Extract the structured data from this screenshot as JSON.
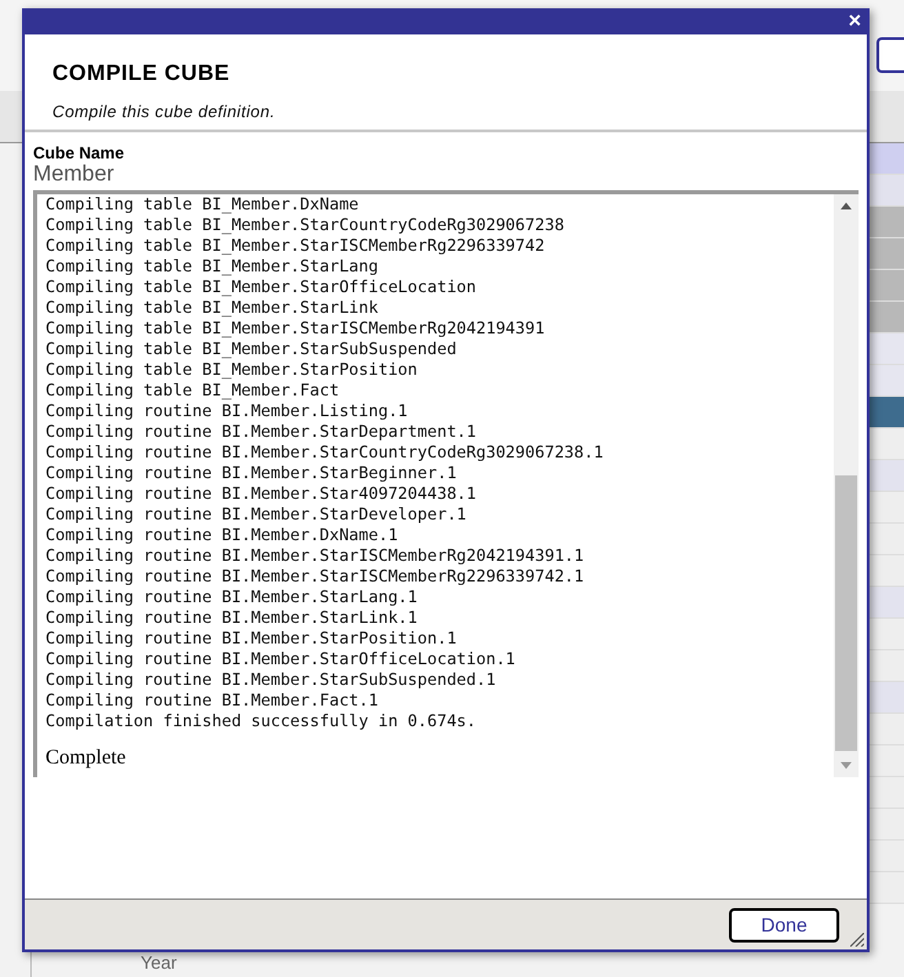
{
  "background": {
    "row_label": "Year"
  },
  "dialog": {
    "close_glyph": "×",
    "title": "COMPILE CUBE",
    "subtitle": "Compile this cube definition.",
    "field": {
      "label": "Cube Name",
      "value": "Member"
    },
    "log": {
      "lines": [
        "Compiling table BI_Member.DxName",
        "Compiling table BI_Member.StarCountryCodeRg3029067238",
        "Compiling table BI_Member.StarISCMemberRg2296339742",
        "Compiling table BI_Member.StarLang",
        "Compiling table BI_Member.StarOfficeLocation",
        "Compiling table BI_Member.StarLink",
        "Compiling table BI_Member.StarISCMemberRg2042194391",
        "Compiling table BI_Member.StarSubSuspended",
        "Compiling table BI_Member.StarPosition",
        "Compiling table BI_Member.Fact",
        "Compiling routine BI.Member.Listing.1",
        "Compiling routine BI.Member.StarDepartment.1",
        "Compiling routine BI.Member.StarCountryCodeRg3029067238.1",
        "Compiling routine BI.Member.StarBeginner.1",
        "Compiling routine BI.Member.Star4097204438.1",
        "Compiling routine BI.Member.StarDeveloper.1",
        "Compiling routine BI.Member.DxName.1",
        "Compiling routine BI.Member.StarISCMemberRg2042194391.1",
        "Compiling routine BI.Member.StarISCMemberRg2296339742.1",
        "Compiling routine BI.Member.StarLang.1",
        "Compiling routine BI.Member.StarLink.1",
        "Compiling routine BI.Member.StarPosition.1",
        "Compiling routine BI.Member.StarOfficeLocation.1",
        "Compiling routine BI.Member.StarSubSuspended.1",
        "Compiling routine BI.Member.Fact.1",
        "Compilation finished successfully in 0.674s."
      ],
      "status": "Complete"
    },
    "buttons": [
      {
        "label": "Done"
      }
    ]
  }
}
